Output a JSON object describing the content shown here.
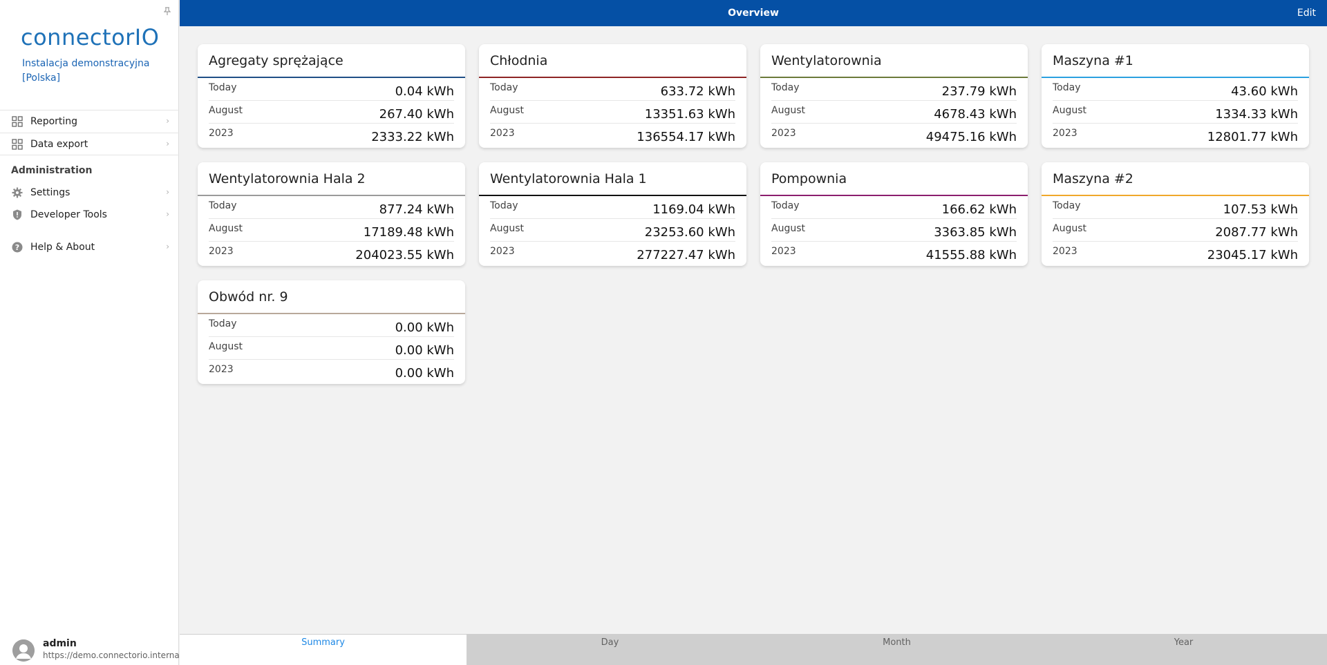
{
  "header": {
    "title": "Overview",
    "edit_label": "Edit"
  },
  "brand": {
    "logo_text": "connectorIO",
    "installation": "Instalacja demonstracyjna [Polska]"
  },
  "sidebar": {
    "top_items": [
      {
        "label": "Reporting",
        "icon": "grid-icon"
      },
      {
        "label": "Data export",
        "icon": "grid-icon"
      }
    ],
    "section_title": "Administration",
    "admin_items": [
      {
        "label": "Settings",
        "icon": "gear-icon"
      },
      {
        "label": "Developer Tools",
        "icon": "shield-icon"
      }
    ],
    "help_item": {
      "label": "Help & About",
      "icon": "help-icon"
    }
  },
  "user": {
    "name": "admin",
    "url": "https://demo.connectorio.internal"
  },
  "cards": [
    {
      "title": "Agregaty sprężające",
      "color": "#1f4f86",
      "rows": [
        {
          "label": "Today",
          "value": "0.04 kWh"
        },
        {
          "label": "August",
          "value": "267.40 kWh"
        },
        {
          "label": "2023",
          "value": "2333.22 kWh"
        }
      ]
    },
    {
      "title": "Chłodnia",
      "color": "#8e2424",
      "rows": [
        {
          "label": "Today",
          "value": "633.72 kWh"
        },
        {
          "label": "August",
          "value": "13351.63 kWh"
        },
        {
          "label": "2023",
          "value": "136554.17 kWh"
        }
      ]
    },
    {
      "title": "Wentylatorownia",
      "color": "#6b7a3a",
      "rows": [
        {
          "label": "Today",
          "value": "237.79 kWh"
        },
        {
          "label": "August",
          "value": "4678.43 kWh"
        },
        {
          "label": "2023",
          "value": "49475.16 kWh"
        }
      ]
    },
    {
      "title": "Maszyna #1",
      "color": "#2aa0e0",
      "rows": [
        {
          "label": "Today",
          "value": "43.60 kWh"
        },
        {
          "label": "August",
          "value": "1334.33 kWh"
        },
        {
          "label": "2023",
          "value": "12801.77 kWh"
        }
      ]
    },
    {
      "title": "Wentylatorownia Hala 2",
      "color": "#9a9a9a",
      "rows": [
        {
          "label": "Today",
          "value": "877.24 kWh"
        },
        {
          "label": "August",
          "value": "17189.48 kWh"
        },
        {
          "label": "2023",
          "value": "204023.55 kWh"
        }
      ]
    },
    {
      "title": "Wentylatorownia Hala 1",
      "color": "#111111",
      "rows": [
        {
          "label": "Today",
          "value": "1169.04 kWh"
        },
        {
          "label": "August",
          "value": "23253.60 kWh"
        },
        {
          "label": "2023",
          "value": "277227.47 kWh"
        }
      ]
    },
    {
      "title": "Pompownia",
      "color": "#8b1e6e",
      "rows": [
        {
          "label": "Today",
          "value": "166.62 kWh"
        },
        {
          "label": "August",
          "value": "3363.85 kWh"
        },
        {
          "label": "2023",
          "value": "41555.88 kWh"
        }
      ]
    },
    {
      "title": "Maszyna #2",
      "color": "#f0a82a",
      "rows": [
        {
          "label": "Today",
          "value": "107.53 kWh"
        },
        {
          "label": "August",
          "value": "2087.77 kWh"
        },
        {
          "label": "2023",
          "value": "23045.17 kWh"
        }
      ]
    },
    {
      "title": "Obwód nr. 9",
      "color": "#b8a89a",
      "rows": [
        {
          "label": "Today",
          "value": "0.00 kWh"
        },
        {
          "label": "August",
          "value": "0.00 kWh"
        },
        {
          "label": "2023",
          "value": "0.00 kWh"
        }
      ]
    }
  ],
  "tabs": [
    "Summary",
    "Day",
    "Month",
    "Year"
  ],
  "active_tab": "Summary",
  "colors": {
    "header": "#0550a5",
    "accent": "#1e88e5",
    "brand": "#1f72b8"
  }
}
